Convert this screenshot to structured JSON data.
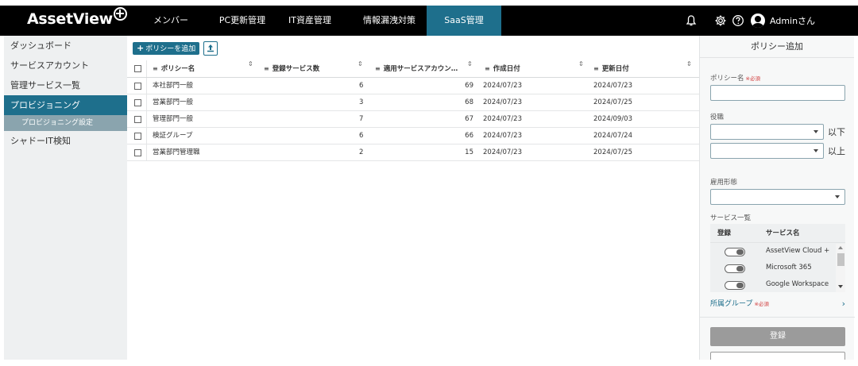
{
  "header": {
    "logo_text": "AssetView",
    "nav": [
      "メンバー",
      "PC更新管理",
      "IT資産管理",
      "情報漏洩対策",
      "SaaS管理"
    ],
    "active_nav": "SaaS管理",
    "user_name": "Adminさん",
    "icons": [
      "bell-icon",
      "gear-icon",
      "help-icon",
      "user-avatar-icon"
    ]
  },
  "sidebar": {
    "items": [
      "ダッシュボード",
      "サービスアカウント",
      "管理サービス一覧",
      "プロビジョニング",
      "シャドーIT検知"
    ],
    "active_item": "プロビジョニング",
    "sub_item": "プロビジョニング設定"
  },
  "toolbar": {
    "add_label": "ポリシーを追加",
    "upload_icon": "upload-icon"
  },
  "table": {
    "columns": [
      "ポリシー名",
      "登録サービス数",
      "適用サービスアカウン…",
      "作成日付",
      "更新日付"
    ],
    "rows": [
      {
        "name": "本社部門一般",
        "services": "6",
        "accounts": "69",
        "created": "2024/07/23",
        "updated": "2024/07/23"
      },
      {
        "name": "営業部門一般",
        "services": "3",
        "accounts": "68",
        "created": "2024/07/23",
        "updated": "2024/07/25"
      },
      {
        "name": "管理部門一般",
        "services": "7",
        "accounts": "67",
        "created": "2024/07/23",
        "updated": "2024/09/03"
      },
      {
        "name": "検証グループ",
        "services": "6",
        "accounts": "66",
        "created": "2024/07/23",
        "updated": "2024/07/24"
      },
      {
        "name": "営業部門管理職",
        "services": "2",
        "accounts": "15",
        "created": "2024/07/23",
        "updated": "2024/07/25"
      }
    ]
  },
  "panel": {
    "title": "ポリシー追加",
    "policy_name_label": "ポリシー名",
    "required_mark": "※必須",
    "position_label": "役職",
    "below_label": "以下",
    "above_label": "以上",
    "employment_label": "雇用形態",
    "service_list_label": "サービス一覧",
    "service_cols": [
      "登録",
      "サービス名"
    ],
    "services": [
      "AssetView Cloud +",
      "Microsoft 365",
      "Google Workspace"
    ],
    "group_label": "所属グループ",
    "register_button": "登録"
  },
  "colors": {
    "accent": "#1e6f8c",
    "topbar": "#000000",
    "sidebar_bg": "#eef0f1",
    "required": "#d03b3b"
  }
}
